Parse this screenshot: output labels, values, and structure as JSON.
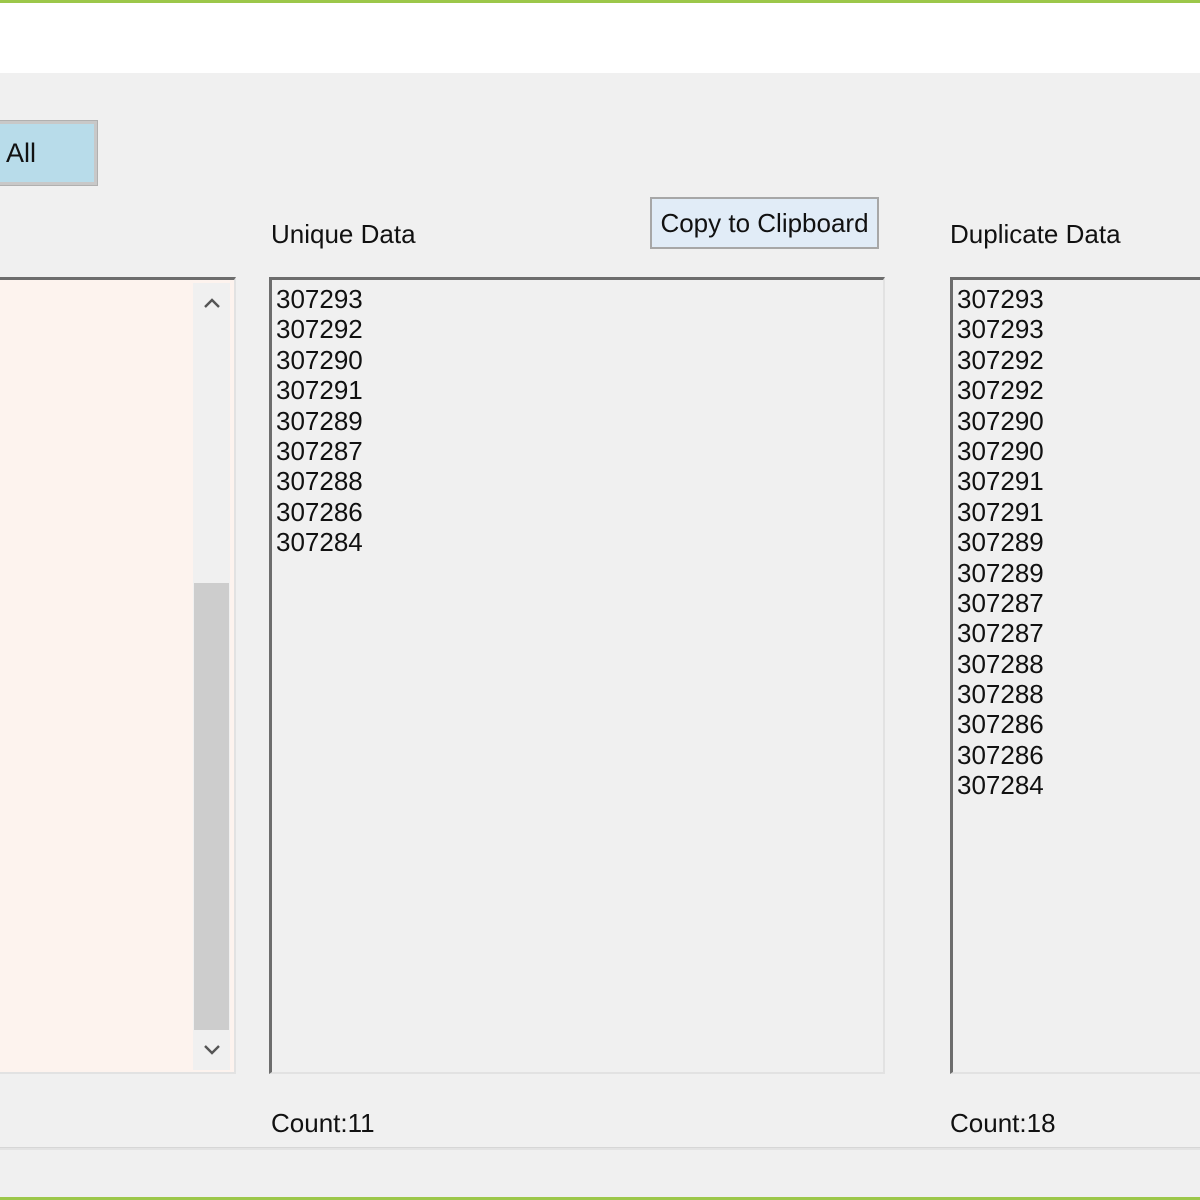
{
  "toolbar": {
    "clear_all_label": "r All",
    "copy_label": "Copy to Clipboard"
  },
  "unique": {
    "header": "Unique Data",
    "items": [
      "307293",
      "307292",
      "307290",
      "307291",
      "307289",
      "307287",
      "307288",
      "307286",
      "307284"
    ],
    "count_label": "Count:11"
  },
  "duplicate": {
    "header": "Duplicate Data",
    "items": [
      "307293",
      "307293",
      "307292",
      "307292",
      "307290",
      "307290",
      "307291",
      "307291",
      "307289",
      "307289",
      "307287",
      "307287",
      "307288",
      "307288",
      "307286",
      "307286",
      "307284"
    ],
    "count_label": "Count:18"
  },
  "icons": {
    "scroll_up": "chevron-up-icon",
    "scroll_down": "chevron-down-icon"
  },
  "colors": {
    "accent": "#9cc74a",
    "clear_button": "#b8dcea",
    "input_background": "#fdf3ee"
  }
}
